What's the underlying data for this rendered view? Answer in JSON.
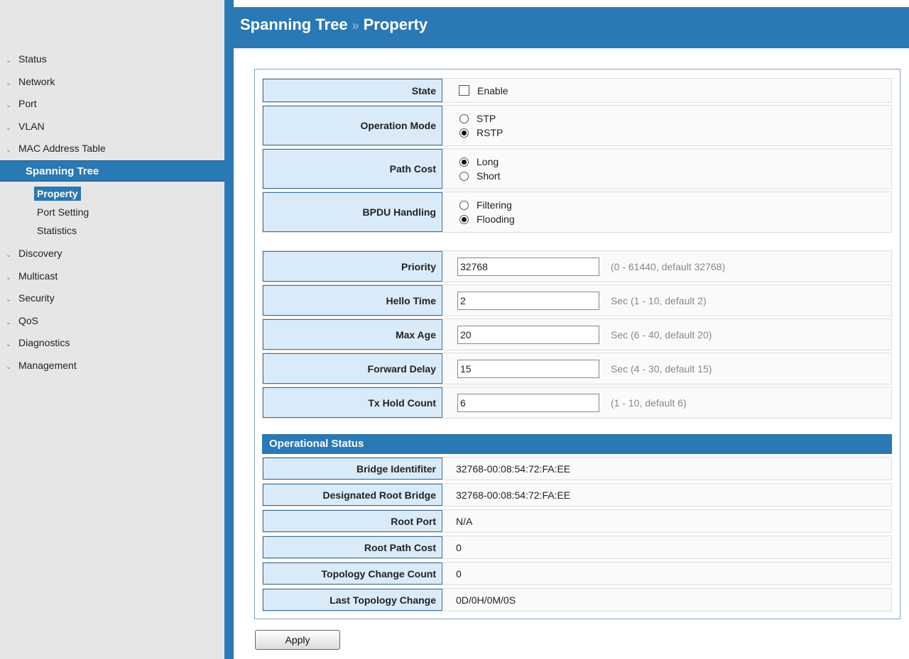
{
  "header": {
    "breadcrumb_parent": "Spanning Tree",
    "breadcrumb_separator": "»",
    "breadcrumb_current": "Property"
  },
  "sidebar": {
    "items": [
      {
        "label": "Status"
      },
      {
        "label": "Network"
      },
      {
        "label": "Port"
      },
      {
        "label": "VLAN"
      },
      {
        "label": "MAC Address Table"
      }
    ],
    "active_section": "Spanning Tree",
    "sub_items": [
      {
        "label": "Property",
        "active": true
      },
      {
        "label": "Port Setting"
      },
      {
        "label": "Statistics"
      }
    ],
    "items_after": [
      {
        "label": "Discovery"
      },
      {
        "label": "Multicast"
      },
      {
        "label": "Security"
      },
      {
        "label": "QoS"
      },
      {
        "label": "Diagnostics"
      },
      {
        "label": "Management"
      }
    ]
  },
  "settings": {
    "state": {
      "label": "State",
      "option": "Enable",
      "checked": false
    },
    "operation_mode": {
      "label": "Operation Mode",
      "options": [
        "STP",
        "RSTP"
      ],
      "selected": "RSTP"
    },
    "path_cost": {
      "label": "Path Cost",
      "options": [
        "Long",
        "Short"
      ],
      "selected": "Long"
    },
    "bpdu_handling": {
      "label": "BPDU Handling",
      "options": [
        "Filtering",
        "Flooding"
      ],
      "selected": "Flooding"
    }
  },
  "params": {
    "priority": {
      "label": "Priority",
      "value": "32768",
      "hint": "(0 - 61440, default 32768)"
    },
    "hello_time": {
      "label": "Hello Time",
      "value": "2",
      "hint": "Sec (1 - 10, default 2)"
    },
    "max_age": {
      "label": "Max Age",
      "value": "20",
      "hint": "Sec (6 - 40, default 20)"
    },
    "forward_delay": {
      "label": "Forward Delay",
      "value": "15",
      "hint": "Sec (4 - 30, default 15)"
    },
    "tx_hold_count": {
      "label": "Tx Hold Count",
      "value": "6",
      "hint": "(1 - 10, default 6)"
    }
  },
  "operational_status": {
    "title": "Operational Status",
    "bridge_identifier": {
      "label": "Bridge Identifiter",
      "value": "32768-00:08:54:72:FA:EE"
    },
    "designated_root_bridge": {
      "label": "Designated Root Bridge",
      "value": "32768-00:08:54:72:FA:EE"
    },
    "root_port": {
      "label": "Root Port",
      "value": "N/A"
    },
    "root_path_cost": {
      "label": "Root Path Cost",
      "value": "0"
    },
    "topology_change_count": {
      "label": "Topology Change Count",
      "value": "0"
    },
    "last_topology_change": {
      "label": "Last Topology Change",
      "value": "0D/0H/0M/0S"
    }
  },
  "actions": {
    "apply_label": "Apply"
  },
  "colors": {
    "accent": "#2a78b4",
    "label_bg": "#d9ebf9"
  }
}
